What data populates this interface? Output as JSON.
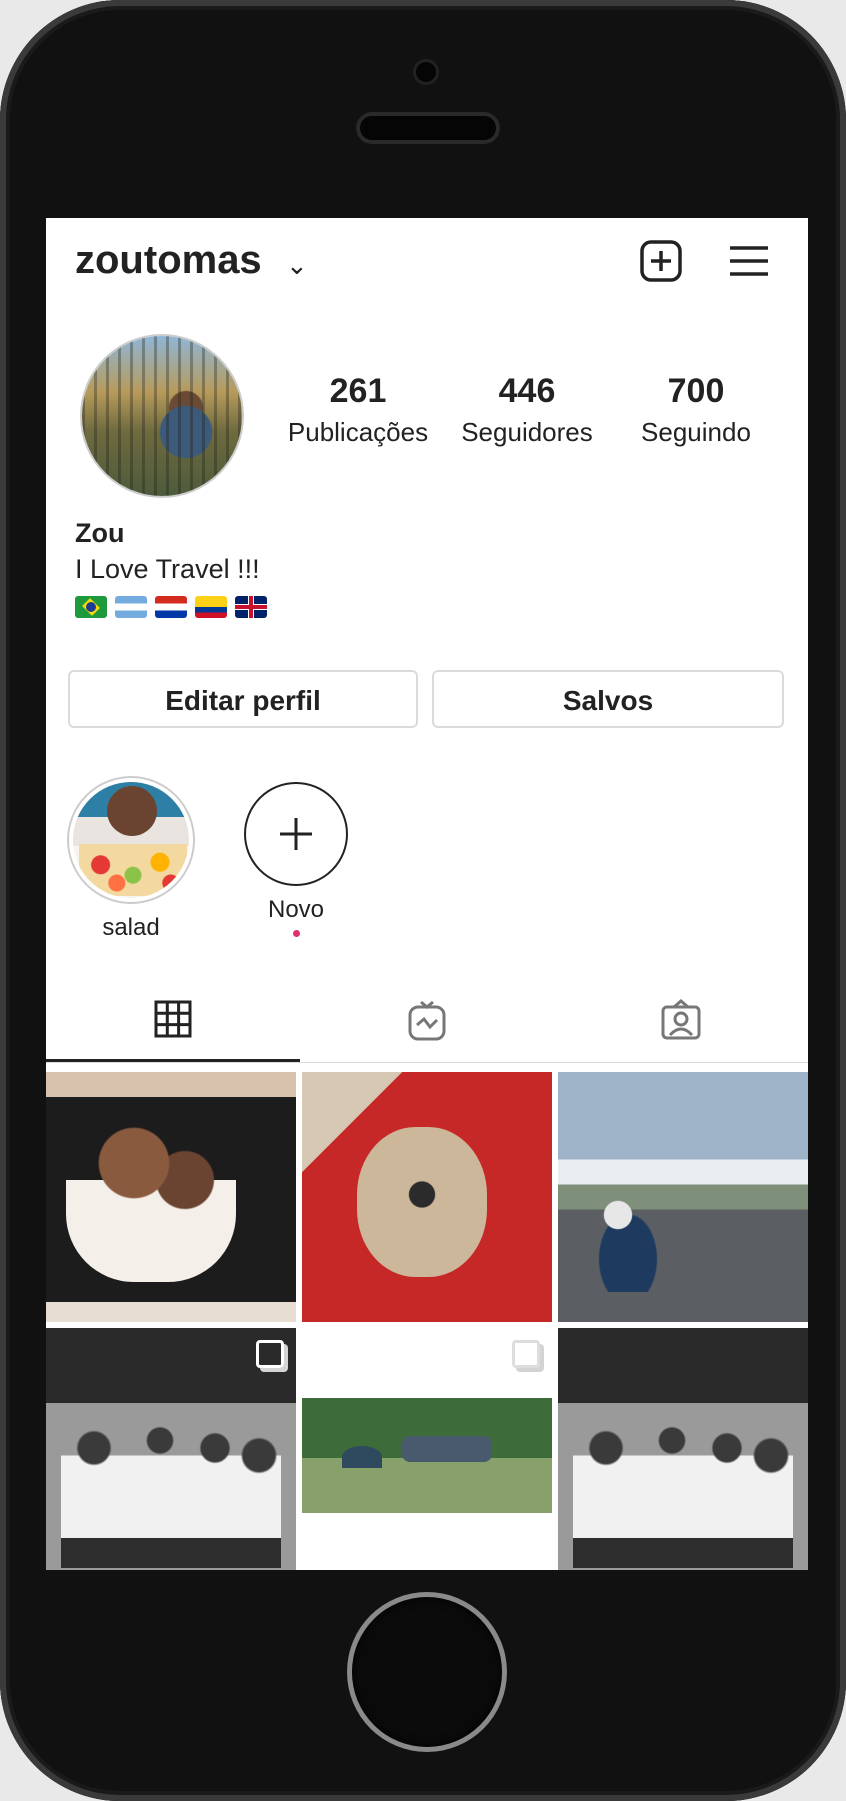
{
  "profile": {
    "username": "zoutomas",
    "stats": [
      {
        "value": "261",
        "label": "Publicações"
      },
      {
        "value": "446",
        "label": "Seguidores"
      },
      {
        "value": "700",
        "label": "Seguindo"
      }
    ],
    "name": "Zou",
    "bio": "I Love Travel !!!",
    "flags": [
      "brazil-flag",
      "argentina-flag",
      "paraguay-flag",
      "colombia-flag",
      "uk-flag"
    ]
  },
  "actions": {
    "edit_profile": "Editar perfil",
    "saved": "Salvos"
  },
  "highlights": [
    {
      "label": "salad"
    },
    {
      "label": "Novo"
    }
  ],
  "tabs": [
    "grid-icon",
    "igtv-icon",
    "tagged-icon"
  ],
  "colors": {
    "accent": "#e1306c",
    "border": "#dbdbdb",
    "text": "#222222"
  }
}
